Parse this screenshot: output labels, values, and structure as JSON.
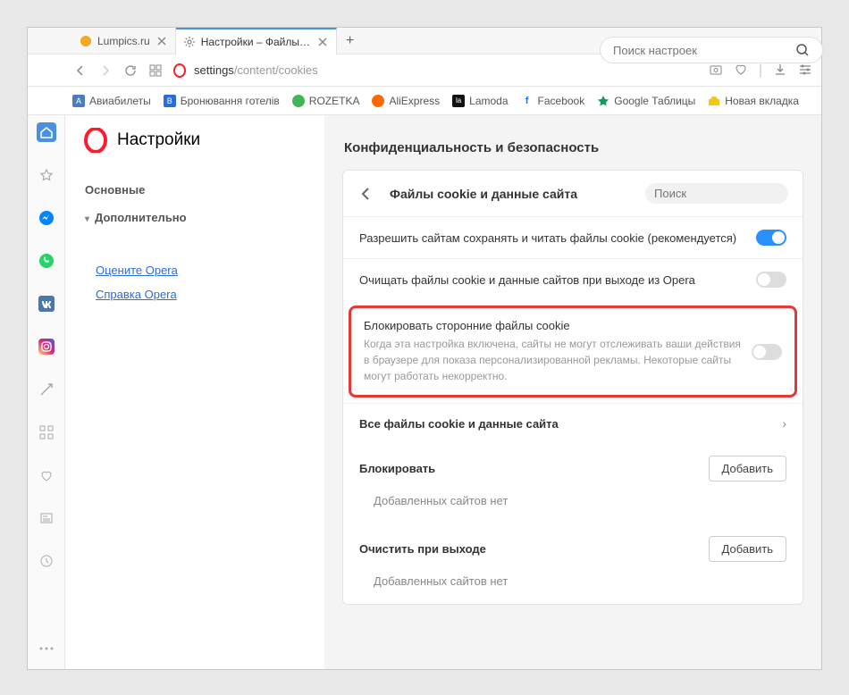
{
  "tabs": [
    {
      "title": "Lumpics.ru",
      "icon_color": "#f5a623"
    },
    {
      "title": "Настройки – Файлы cookie",
      "icon_color": "#888"
    }
  ],
  "address": {
    "prefix": "settings",
    "path": "/content/cookies"
  },
  "bookmarks": [
    {
      "label": "Авиабилеты",
      "color": "#4a7dbf"
    },
    {
      "label": "Бронювання готелів",
      "color": "#2b6cd6"
    },
    {
      "label": "ROZETKA",
      "color": "#44b556"
    },
    {
      "label": "AliExpress",
      "color": "#ff6a00"
    },
    {
      "label": "Lamoda",
      "color": "#111"
    },
    {
      "label": "Facebook",
      "color": "#1877f2"
    },
    {
      "label": "Google Таблицы",
      "color": "#0f9d58"
    },
    {
      "label": "Новая вкладка",
      "color": "#f5c518"
    }
  ],
  "settings_title": "Настройки",
  "top_search_placeholder": "Поиск настроек",
  "side_nav": {
    "basic": "Основные",
    "advanced": "Дополнительно"
  },
  "side_links": {
    "rate": "Оцените Opera",
    "help": "Справка Opera"
  },
  "section_title": "Конфиденциальность и безопасность",
  "card": {
    "title": "Файлы cookie и данные сайта",
    "search_placeholder": "Поиск",
    "row_allow": "Разрешить сайтам сохранять и читать файлы cookie (рекомендуется)",
    "row_clear_exit": "Очищать файлы cookie и данные сайтов при выходе из Opera",
    "row_block_title": "Блокировать сторонние файлы cookie",
    "row_block_sub": "Когда эта настройка включена, сайты не могут отслеживать ваши действия в браузере для показа персонализированной рекламы. Некоторые сайты могут работать некорректно.",
    "row_all_data": "Все файлы cookie и данные сайта",
    "block_heading": "Блокировать",
    "clear_exit_heading": "Очистить при выходе",
    "add_btn": "Добавить",
    "empty_sites": "Добавленных сайтов нет"
  }
}
